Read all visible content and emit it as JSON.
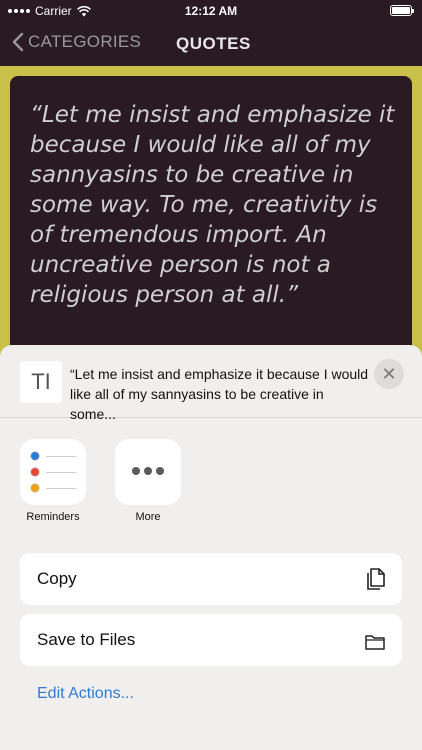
{
  "status": {
    "carrier": "Carrier",
    "time": "12:12 AM"
  },
  "nav": {
    "back_label": "CATEGORIES",
    "title": "QUOTES"
  },
  "quote": {
    "text": "“Let me insist and emphasize it because I would like all of my sannyasins to be creative in some way. To me, creativity is of tremendous import. An uncreative person is not a religious person at all.”"
  },
  "share_sheet": {
    "thumb_glyph": "TI",
    "preview_text": "“Let me insist and emphasize it because I would like all of my sannyasins to be creative in some...",
    "close_glyph": "✕",
    "apps": [
      {
        "label": "Reminders"
      },
      {
        "label": "More"
      }
    ],
    "actions": [
      {
        "label": "Copy",
        "icon": "copy-icon"
      },
      {
        "label": "Save to Files",
        "icon": "folder-icon"
      }
    ],
    "edit_actions_label": "Edit Actions..."
  },
  "colors": {
    "nav_bg": "#2a1a22",
    "page_bg": "#c9c04a",
    "sheet_bg": "#f1efed",
    "link_blue": "#2f7ad6",
    "reminder_dots": [
      "#2f7ad6",
      "#e04a3a",
      "#f0a020"
    ]
  }
}
